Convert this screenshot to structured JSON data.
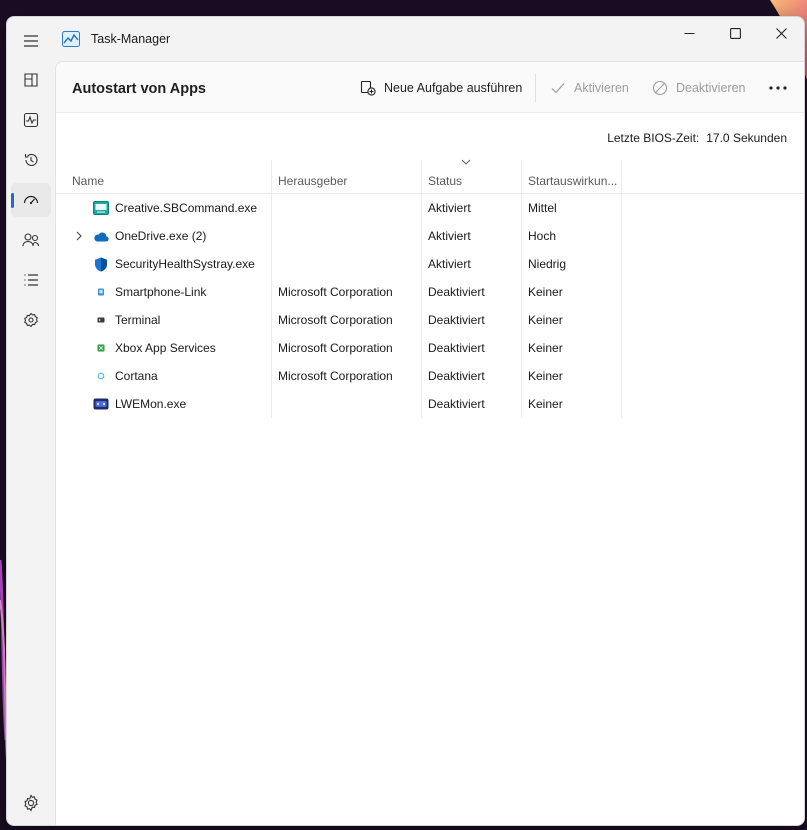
{
  "window": {
    "title": "Task-Manager"
  },
  "sidebar": {
    "items": [
      {
        "name": "Prozesse",
        "icon": "processes-icon"
      },
      {
        "name": "Leistung",
        "icon": "performance-icon"
      },
      {
        "name": "App-Verlauf",
        "icon": "history-icon"
      },
      {
        "name": "Autostart von Apps",
        "icon": "startup-icon",
        "active": true
      },
      {
        "name": "Benutzer",
        "icon": "users-icon"
      },
      {
        "name": "Details",
        "icon": "details-icon"
      },
      {
        "name": "Dienste",
        "icon": "services-icon"
      }
    ],
    "settings_icon": "gear-icon"
  },
  "page": {
    "title": "Autostart von Apps"
  },
  "toolbar": {
    "run_task_label": "Neue Aufgabe ausführen",
    "activate_label": "Aktivieren",
    "deactivate_label": "Deaktivieren"
  },
  "bios": {
    "label": "Letzte BIOS-Zeit:",
    "value": "17.0 Sekunden"
  },
  "table": {
    "columns": {
      "name": "Name",
      "publisher": "Herausgeber",
      "status": "Status",
      "impact": "Startauswirkun..."
    },
    "rows": [
      {
        "name": "Creative.SBCommand.exe",
        "publisher": "",
        "status": "Aktiviert",
        "impact": "Mittel",
        "icon": "creative-app-icon"
      },
      {
        "name": "OneDrive.exe (2)",
        "publisher": "",
        "status": "Aktiviert",
        "impact": "Hoch",
        "icon": "onedrive-cloud-icon",
        "expandable": true
      },
      {
        "name": "SecurityHealthSystray.exe",
        "publisher": "",
        "status": "Aktiviert",
        "impact": "Niedrig",
        "icon": "security-shield-icon"
      },
      {
        "name": "Smartphone-Link",
        "publisher": "Microsoft Corporation",
        "status": "Deaktiviert",
        "impact": "Keiner",
        "icon": "phone-link-icon"
      },
      {
        "name": "Terminal",
        "publisher": "Microsoft Corporation",
        "status": "Deaktiviert",
        "impact": "Keiner",
        "icon": "terminal-icon"
      },
      {
        "name": "Xbox App Services",
        "publisher": "Microsoft Corporation",
        "status": "Deaktiviert",
        "impact": "Keiner",
        "icon": "xbox-icon"
      },
      {
        "name": "Cortana",
        "publisher": "Microsoft Corporation",
        "status": "Deaktiviert",
        "impact": "Keiner",
        "icon": "cortana-icon"
      },
      {
        "name": "LWEMon.exe",
        "publisher": "",
        "status": "Deaktiviert",
        "impact": "Keiner",
        "icon": "lwemon-app-icon"
      }
    ]
  },
  "colors": {
    "accent": "#2b66c9",
    "window_bg": "#f3f3f3",
    "content_bg": "#ffffff"
  }
}
